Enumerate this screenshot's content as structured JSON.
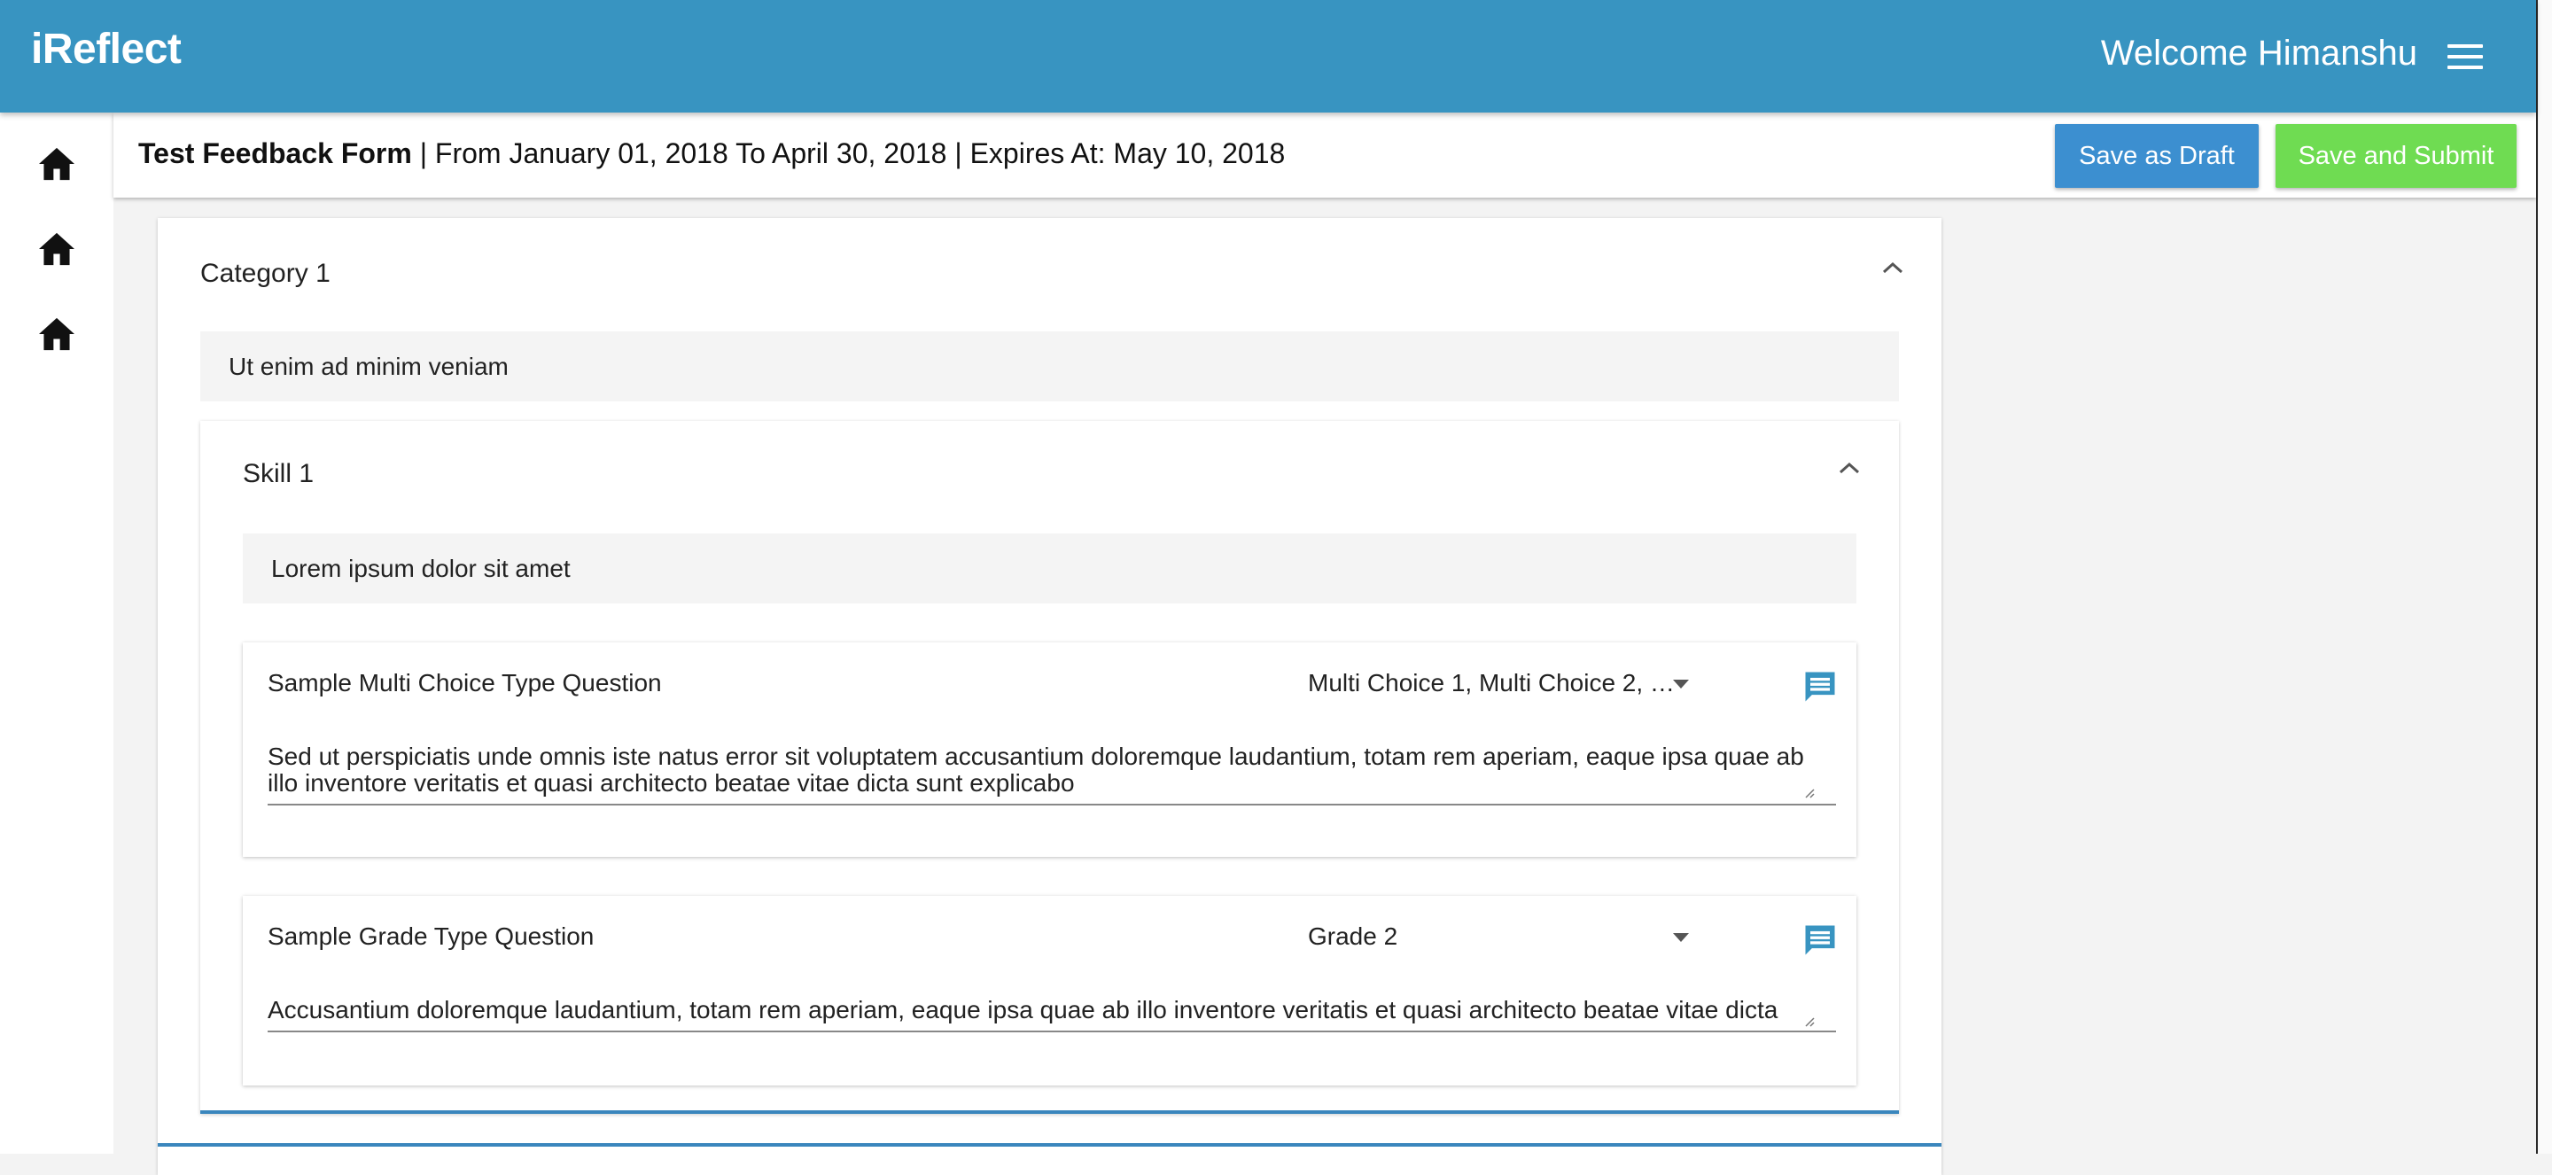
{
  "app": {
    "brand": "iReflect",
    "welcome": "Welcome Himanshu"
  },
  "sidebar": {
    "items": [
      {
        "icon": "home-icon"
      },
      {
        "icon": "home-icon"
      },
      {
        "icon": "home-icon"
      }
    ]
  },
  "form": {
    "title": "Test Feedback Form",
    "period": "|  From January 01, 2018 To April 30, 2018 |  Expires At: May 10, 2018",
    "save_draft_label": "Save as Draft",
    "save_submit_label": "Save and Submit"
  },
  "category": {
    "title": "Category 1",
    "description": "Ut enim ad minim veniam",
    "skill": {
      "title": "Skill 1",
      "description": "Lorem ipsum dolor sit amet",
      "questions": [
        {
          "label": "Sample Multi Choice Type Question",
          "selected": "Multi Choice 1, Multi Choice 2, …",
          "answer": "Sed ut perspiciatis unde omnis iste natus error sit voluptatem accusantium doloremque laudantium, totam rem aperiam, eaque ipsa quae ab illo inventore veritatis et quasi architecto beatae vitae dicta sunt explicabo"
        },
        {
          "label": "Sample Grade Type Question",
          "selected": "Grade 2",
          "answer": "Accusantium doloremque laudantium, totam rem aperiam, eaque ipsa quae ab illo inventore veritatis et quasi architecto beatae vitae dicta"
        }
      ]
    }
  },
  "colors": {
    "header": "#3894c1",
    "draft_button": "#3c8fd0",
    "submit_button": "#6fdc52",
    "comment_icon": "#3894c1",
    "accent_border": "#3a86bd"
  }
}
